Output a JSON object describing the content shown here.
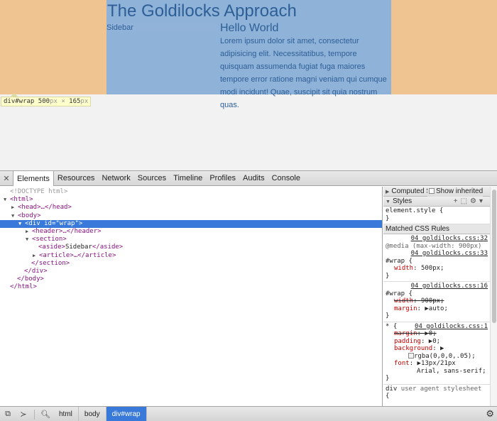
{
  "page": {
    "title": "The Goldilocks Approach",
    "sidebar_text": "Sidebar",
    "article_title": "Hello World",
    "article_body": "Lorem ipsum dolor sit amet, consectetur adipisicing elit. Necessitatibus, tempore quisquam assumenda fugiat fuga maiores tempore error ratione magni veniam qui cumque modi incidunt! Quae, suscipit sit quia nostrum quas.",
    "tooltip_selector": "div#wrap",
    "tooltip_width": "500",
    "tooltip_height": "165",
    "tooltip_unit": "px",
    "tooltip_times": "×",
    "colors": {
      "margin": "#f0c491",
      "content": "#8fb2d9",
      "text": "#2d5f96"
    }
  },
  "devtools": {
    "close_icon": "close-icon",
    "tabs": [
      "Elements",
      "Resources",
      "Network",
      "Sources",
      "Timeline",
      "Profiles",
      "Audits",
      "Console"
    ],
    "active_tab": "Elements",
    "dom": {
      "doctype": "<!DOCTYPE html>",
      "html_open": "<html>",
      "head": "<head>…</head>",
      "body_open": "<body>",
      "div_open_tag": "<div",
      "div_attr": "id",
      "div_attr_val": "\"wrap\"",
      "div_open_close": ">",
      "header": "<header>…</header>",
      "section_open": "<section>",
      "aside_open": "<aside>",
      "aside_text": "Sidebar",
      "aside_close": "</aside>",
      "article": "<article>…</article>",
      "section_close": "</section>",
      "div_close": "</div>",
      "body_close": "</body>",
      "html_close": "</html>"
    },
    "styles": {
      "computed_label": "Computed Style",
      "show_inherited_label": "Show inherited",
      "styles_label": "Styles",
      "element_style": "element.style {",
      "close_brace": "}",
      "matched_label": "Matched CSS Rules",
      "rule1": {
        "source": "04 goldilocks.css:32",
        "media": "@media (max-width: 900px)",
        "source2": "04 goldilocks.css:33",
        "selector": "#wrap {",
        "props": [
          {
            "name": "width",
            "value": "500px;",
            "struck": false
          }
        ]
      },
      "rule2": {
        "source": "04 goldilocks.css:16",
        "selector": "#wrap {",
        "props": [
          {
            "name": "width",
            "value": "900px;",
            "struck": true
          },
          {
            "name": "margin",
            "value": "▶auto;",
            "struck": false
          }
        ]
      },
      "rule3": {
        "selector": "* {",
        "source": "04 goldilocks.css:1",
        "props": [
          {
            "name": "margin",
            "value": "▶0;",
            "struck": true
          },
          {
            "name": "padding",
            "value": "▶0;",
            "struck": false
          },
          {
            "name": "background",
            "value": "▶",
            "struck": false
          },
          {
            "name": "",
            "value": "rgba(0,0,0,.05);",
            "struck": false,
            "swatch": true
          },
          {
            "name": "font",
            "value": "▶13px/21px",
            "struck": false
          },
          {
            "name": "",
            "value": "Arial, sans-serif;",
            "struck": false
          }
        ]
      },
      "ua_selector": "div",
      "ua_label": "user agent stylesheet",
      "ua_open": "{"
    },
    "breadcrumbs": [
      "html",
      "body",
      "div#wrap"
    ],
    "active_breadcrumb": "div#wrap"
  }
}
